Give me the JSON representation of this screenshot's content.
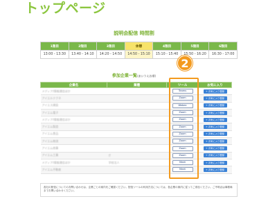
{
  "page": {
    "title": "トップページ"
  },
  "schedule": {
    "heading": "説明会配信 時間割",
    "columns": [
      {
        "label": "1限目",
        "time": "13:00 - 13:30"
      },
      {
        "label": "2限目",
        "time": "13:40 - 14:10"
      },
      {
        "label": "3限目",
        "time": "14:20 - 14:50"
      },
      {
        "label": "休憩",
        "time": "14:50 - 15:10",
        "lunch": true
      },
      {
        "label": "4限目",
        "time": "15:10 - 15:40"
      },
      {
        "label": "5限目",
        "time": "15:50 - 16:20"
      },
      {
        "label": "6限目",
        "time": "16:30 - 17:00"
      }
    ]
  },
  "companies": {
    "heading": "参加企業一覧",
    "heading_note": "(あいうえお順)",
    "headers": {
      "name": "企業名",
      "industry": "業種",
      "tool": "ツール",
      "fav": "お気に入り"
    },
    "fav_label": "+ お気に入り登録",
    "rows": [
      {
        "name": "メディア/情報通信ほか",
        "industry": "",
        "tool": "Teams"
      },
      {
        "name": "アイエルテクネ",
        "industry": "",
        "tool": "Zoom"
      },
      {
        "name": "アイエス建設",
        "industry": "",
        "tool": "Webex"
      },
      {
        "name": "アイエム電子",
        "industry": "",
        "tool": "Zoom"
      },
      {
        "name": "メディア/情報通信ほか",
        "industry": "",
        "tool": "Zoom"
      },
      {
        "name": "アイエム製造",
        "industry": "",
        "tool": "Zoom"
      },
      {
        "name": "アイエム食品",
        "industry": "",
        "tool": "Zoom"
      },
      {
        "name": "アイエム物流",
        "industry": "",
        "tool": "Zoom"
      },
      {
        "name": "アイエム商事",
        "industry": "",
        "tool": "Zoom"
      },
      {
        "name": "アイエム工業",
        "industry": "IT",
        "tool": "Zoom"
      },
      {
        "name": "メディア/情報通信ほか",
        "industry": "学校法人",
        "tool": "Meet"
      },
      {
        "name": "アイエム不動産",
        "industry": "",
        "tool": "Meet"
      }
    ]
  },
  "annotation": {
    "badge": "2"
  },
  "notice": {
    "text": "各社の配信についてのお問い合わせは、企業ごとの案内をご確認ください。配信ツールの利用方法については、各企業の案内に従ってご参加ください。ご不明点は事務局までお問い合わせください。"
  }
}
